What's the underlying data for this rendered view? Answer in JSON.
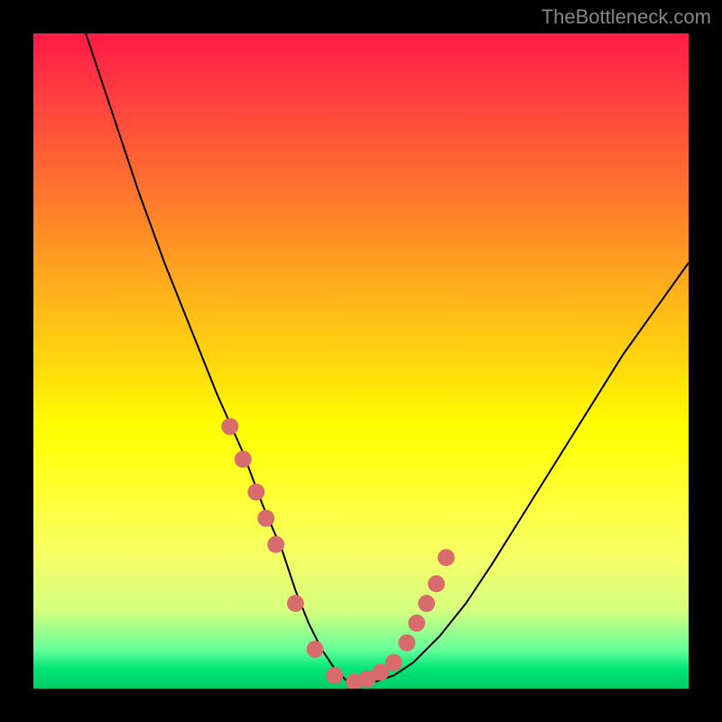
{
  "watermark": "TheBottleneck.com",
  "chart_data": {
    "type": "line",
    "title": "",
    "xlabel": "",
    "ylabel": "",
    "xlim": [
      0,
      100
    ],
    "ylim": [
      0,
      100
    ],
    "series": [
      {
        "name": "curve",
        "type": "line",
        "x": [
          8,
          12,
          16,
          20,
          24,
          28,
          32,
          35,
          38,
          40,
          42,
          44,
          46,
          48,
          52,
          55,
          58,
          62,
          66,
          70,
          75,
          80,
          85,
          90,
          95,
          100
        ],
        "y": [
          100,
          88,
          76,
          65,
          55,
          45,
          36,
          28,
          21,
          15,
          10,
          6,
          3,
          1,
          1,
          2,
          4,
          8,
          13,
          19,
          27,
          35,
          43,
          51,
          58,
          65
        ]
      },
      {
        "name": "dots",
        "type": "scatter",
        "x": [
          30,
          32,
          34,
          35.5,
          37,
          40,
          43,
          46,
          49,
          51,
          53,
          55,
          57,
          58.5,
          60,
          61.5,
          63
        ],
        "y": [
          40,
          35,
          30,
          26,
          22,
          13,
          6,
          2,
          1,
          1.5,
          2.5,
          4,
          7,
          10,
          13,
          16,
          20
        ]
      }
    ],
    "background_gradient": {
      "top": "#ff1a46",
      "mid": "#ffff00",
      "bottom": "#00cc66"
    }
  }
}
